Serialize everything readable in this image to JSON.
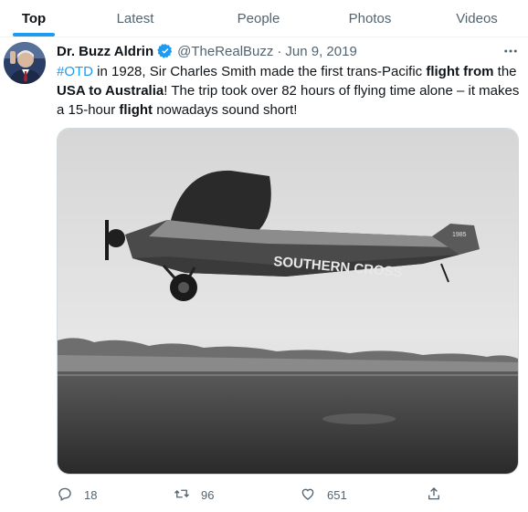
{
  "tabs": [
    {
      "label": "Top",
      "active": true
    },
    {
      "label": "Latest",
      "active": false
    },
    {
      "label": "People",
      "active": false
    },
    {
      "label": "Photos",
      "active": false
    },
    {
      "label": "Videos",
      "active": false
    }
  ],
  "tweet": {
    "author_name": "Dr. Buzz Aldrin",
    "handle": "@TheRealBuzz",
    "separator": "·",
    "date": "Jun 9, 2019",
    "more_icon": "more-horizontal-icon",
    "text_parts": {
      "hashtag": "#OTD",
      "p1": " in 1928, Sir Charles Smith made the first trans-Pacific ",
      "b1": "flight from",
      "p2": " the ",
      "b2": "USA to Australia",
      "p3": "! The trip took over 82 hours of flying time alone – it makes a 15-hour ",
      "b3": "flight",
      "p4": " nowadays sound short!"
    },
    "media": {
      "plane_lettering": "SOUTHERN CROSS",
      "tail_number": "1985"
    },
    "actions": {
      "reply_count": "18",
      "retweet_count": "96",
      "like_count": "651"
    }
  },
  "colors": {
    "accent": "#1d9bf0",
    "secondary_text": "#536471",
    "primary_text": "#0f1419"
  }
}
